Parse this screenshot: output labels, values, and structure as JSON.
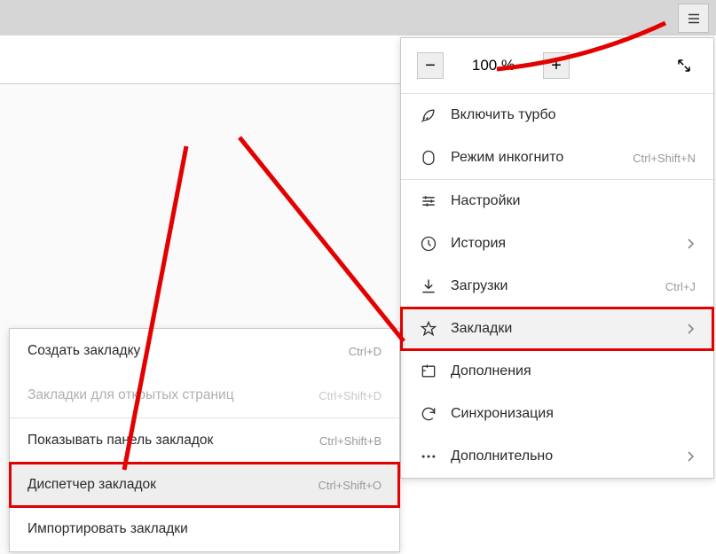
{
  "zoom": {
    "minus": "−",
    "value": "100 %",
    "plus": "+"
  },
  "menu": {
    "turbo": "Включить турбо",
    "incognito": "Режим инкогнито",
    "incognito_sc": "Ctrl+Shift+N",
    "settings": "Настройки",
    "history": "История",
    "downloads": "Загрузки",
    "downloads_sc": "Ctrl+J",
    "bookmarks": "Закладки",
    "addons": "Дополнения",
    "sync": "Синхронизация",
    "more": "Дополнительно"
  },
  "submenu": {
    "create": "Создать закладку",
    "create_sc": "Ctrl+D",
    "open_tabs": "Закладки для открытых страниц",
    "open_tabs_sc": "Ctrl+Shift+D",
    "show_bar": "Показывать панель закладок",
    "show_bar_sc": "Ctrl+Shift+B",
    "manager": "Диспетчер закладок",
    "manager_sc": "Ctrl+Shift+O",
    "import": "Импортировать закладки"
  }
}
